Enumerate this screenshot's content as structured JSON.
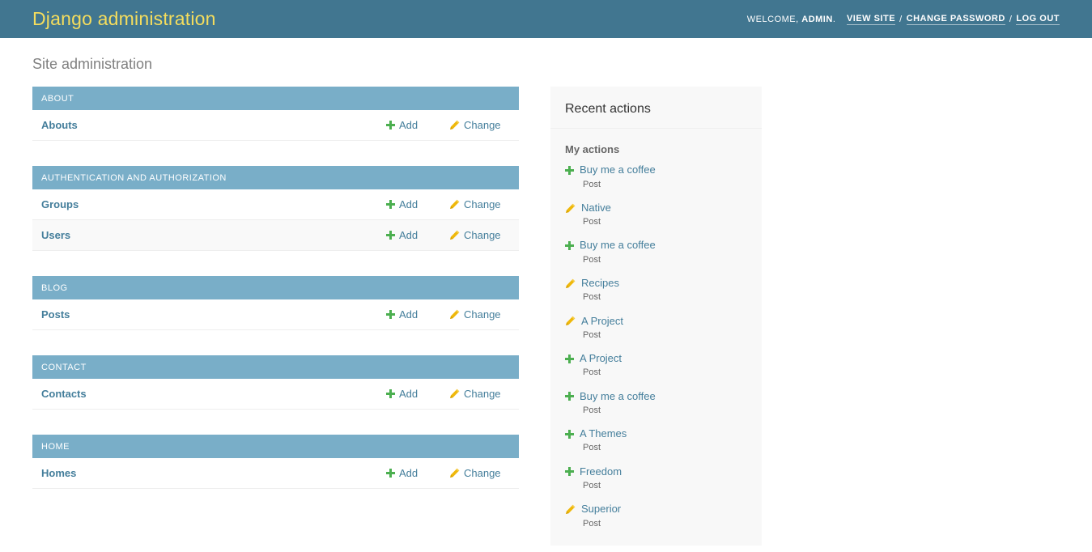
{
  "header": {
    "branding_title": "Django administration",
    "welcome_prefix": "WELCOME, ",
    "username": "ADMIN",
    "welcome_suffix": ".",
    "links": [
      {
        "label": "VIEW SITE",
        "name": "view-site-link"
      },
      {
        "label": "CHANGE PASSWORD",
        "name": "change-password-link"
      },
      {
        "label": "LOG OUT",
        "name": "log-out-link"
      }
    ],
    "separator": "/"
  },
  "page": {
    "title": "Site administration"
  },
  "labels": {
    "add": "Add",
    "change": "Change"
  },
  "colors": {
    "header_bg": "#417690",
    "brand_text": "#f5dd5d",
    "module_caption_bg": "#79aec8",
    "link": "#447e9b",
    "add_icon": "#4CAF50",
    "change_icon": "#efb80b",
    "sidebar_bg": "#f8f8f8"
  },
  "app_list": [
    {
      "caption": "ABOUT",
      "models": [
        {
          "name": "Abouts",
          "add": "Add",
          "change": "Change"
        }
      ]
    },
    {
      "caption": "AUTHENTICATION AND AUTHORIZATION",
      "models": [
        {
          "name": "Groups",
          "add": "Add",
          "change": "Change"
        },
        {
          "name": "Users",
          "add": "Add",
          "change": "Change"
        }
      ]
    },
    {
      "caption": "BLOG",
      "models": [
        {
          "name": "Posts",
          "add": "Add",
          "change": "Change"
        }
      ]
    },
    {
      "caption": "CONTACT",
      "models": [
        {
          "name": "Contacts",
          "add": "Add",
          "change": "Change"
        }
      ]
    },
    {
      "caption": "HOME",
      "models": [
        {
          "name": "Homes",
          "add": "Add",
          "change": "Change"
        }
      ]
    }
  ],
  "sidebar": {
    "title": "Recent actions",
    "subtitle": "My actions",
    "actions": [
      {
        "icon": "add-icon",
        "title": "Buy me a coffee",
        "model": "Post"
      },
      {
        "icon": "change-icon",
        "title": "Native",
        "model": "Post"
      },
      {
        "icon": "add-icon",
        "title": "Buy me a coffee",
        "model": "Post"
      },
      {
        "icon": "change-icon",
        "title": "Recipes",
        "model": "Post"
      },
      {
        "icon": "change-icon",
        "title": "A Project",
        "model": "Post"
      },
      {
        "icon": "add-icon",
        "title": "A Project",
        "model": "Post"
      },
      {
        "icon": "add-icon",
        "title": "Buy me a coffee",
        "model": "Post"
      },
      {
        "icon": "add-icon",
        "title": "A Themes",
        "model": "Post"
      },
      {
        "icon": "add-icon",
        "title": "Freedom",
        "model": "Post"
      },
      {
        "icon": "change-icon",
        "title": "Superior",
        "model": "Post"
      }
    ]
  }
}
